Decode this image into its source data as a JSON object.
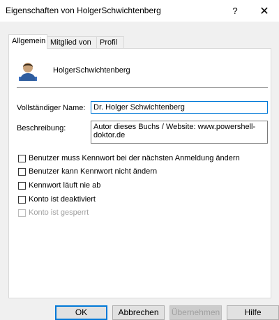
{
  "window": {
    "title": "Eigenschaften von HolgerSchwichtenberg",
    "help_glyph": "?",
    "close_glyph": "✕"
  },
  "tabs": [
    {
      "label": "Allgemein",
      "active": true
    },
    {
      "label": "Mitglied von",
      "active": false
    },
    {
      "label": "Profil",
      "active": false
    }
  ],
  "user": {
    "icon": "user-account-icon",
    "name": "HolgerSchwichtenberg"
  },
  "fields": {
    "fullname_label": "Vollständiger Name:",
    "fullname_value": "Dr. Holger Schwichtenberg",
    "description_label": "Beschreibung:",
    "description_value": "Autor dieses Buchs / Website: www.powershell-doktor.de"
  },
  "checkboxes": [
    {
      "label": "Benutzer muss Kennwort bei der nächsten Anmeldung ändern",
      "checked": false,
      "enabled": true
    },
    {
      "label": "Benutzer kann Kennwort nicht ändern",
      "checked": false,
      "enabled": true
    },
    {
      "label": "Kennwort läuft nie ab",
      "checked": false,
      "enabled": true
    },
    {
      "label": "Konto ist deaktiviert",
      "checked": false,
      "enabled": true
    },
    {
      "label": "Konto ist gesperrt",
      "checked": false,
      "enabled": false
    }
  ],
  "buttons": {
    "ok": "OK",
    "cancel": "Abbrechen",
    "apply": "Übernehmen",
    "help": "Hilfe"
  },
  "colors": {
    "accent": "#0078d7",
    "disabled_text": "#a0a0a0"
  }
}
